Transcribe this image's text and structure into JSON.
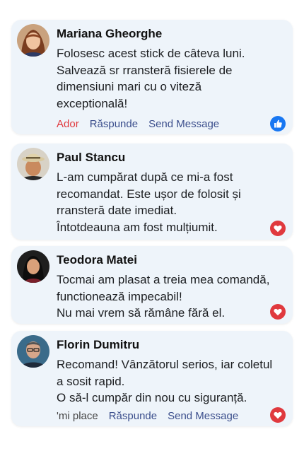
{
  "comments": [
    {
      "name": "Mariana Gheorghe",
      "lines": [
        "Folosesc acest stick de câteva luni.",
        "Salvează sr rransteră fisierele de",
        "dimensiuni mari cu o viteză",
        "exceptională!"
      ],
      "actions": {
        "react": "Ador",
        "reply": "Răspunde",
        "message": "Send Message"
      },
      "reaction_icon": "like-icon",
      "colors": {
        "react_label": "#e0393e",
        "reaction": "#1877f2"
      }
    },
    {
      "name": "Paul Stancu",
      "lines": [
        "L-am cumpărat după ce mi-a fost",
        "recomandat. Este ușor de folosit și",
        "rransteră date imediat.",
        "Întotdeauna am fost mulțiumit."
      ],
      "reaction_icon": "heart-icon",
      "colors": {
        "reaction": "#e0393e"
      }
    },
    {
      "name": "Teodora Matei",
      "lines": [
        "Tocmai am plasat a treia mea comandă,",
        "functionează impecabil!",
        "Nu mai vrem să rămâne fără el."
      ],
      "reaction_icon": "heart-icon",
      "colors": {
        "reaction": "#e0393e"
      }
    },
    {
      "name": "Florin Dumitru",
      "lines": [
        "Recomand! Vânzătorul serios, iar coletul",
        "a sosit rapid.",
        "O să-l cumpăr din nou cu siguranță."
      ],
      "actions": {
        "react": "'mi place",
        "reply": "Răspunde",
        "message": "Send Message"
      },
      "reaction_icon": "heart-icon",
      "colors": {
        "reaction": "#e0393e"
      }
    }
  ],
  "colors": {
    "card_bg": "#eef4fa",
    "link": "#3b4e8c"
  }
}
